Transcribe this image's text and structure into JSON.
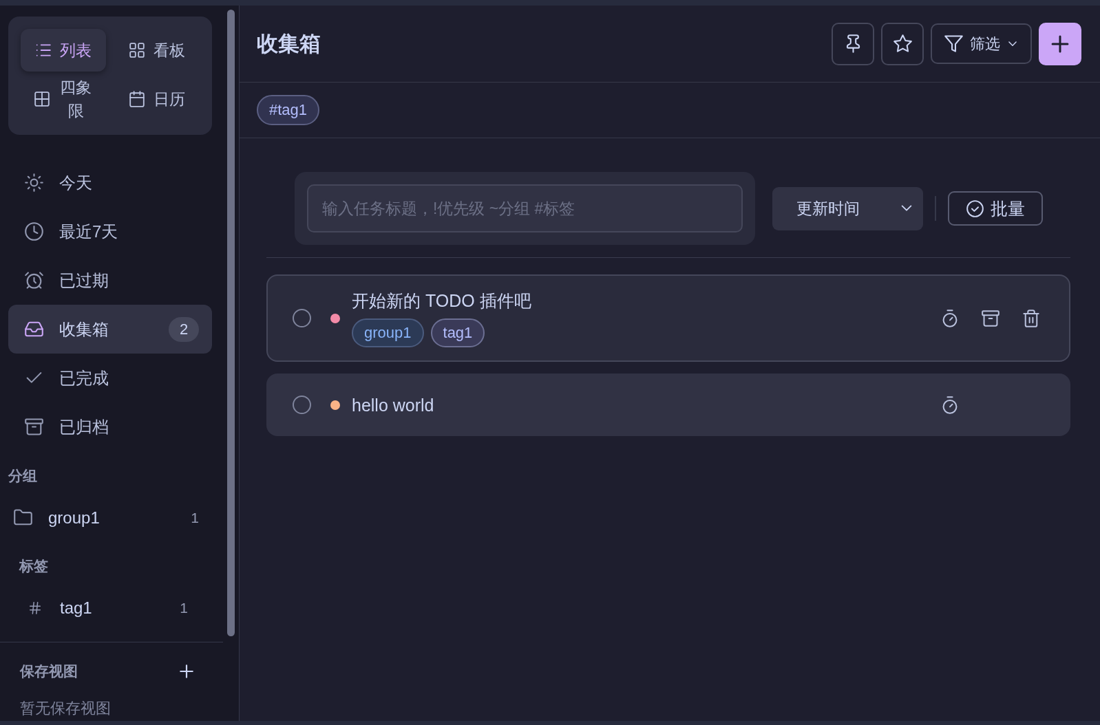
{
  "sidebar": {
    "views": [
      {
        "kind": "list",
        "label": "列表",
        "selected": true
      },
      {
        "kind": "kanban",
        "label": "看板",
        "selected": false
      },
      {
        "kind": "quadrant",
        "label": "四象限",
        "selected": false
      },
      {
        "kind": "calendar",
        "label": "日历",
        "selected": false
      }
    ],
    "nav": [
      {
        "kind": "today",
        "label": "今天",
        "selected": false
      },
      {
        "kind": "next7",
        "label": "最近7天",
        "selected": false
      },
      {
        "kind": "overdue",
        "label": "已过期",
        "selected": false
      },
      {
        "kind": "inbox",
        "label": "收集箱",
        "selected": true,
        "count": "2"
      },
      {
        "kind": "completed",
        "label": "已完成",
        "selected": false
      },
      {
        "kind": "archived",
        "label": "已归档",
        "selected": false
      }
    ],
    "groups": {
      "title": "分组",
      "items": [
        {
          "label": "group1",
          "count": "1",
          "selected": false
        }
      ]
    },
    "tags": {
      "title": "标签",
      "items": [
        {
          "label": "tag1",
          "count": "1",
          "selected": false
        }
      ]
    },
    "saved_views": {
      "title": "保存视图",
      "empty_text": "暂无保存视图"
    }
  },
  "main": {
    "title": "收集箱",
    "toolbar": [
      {
        "kind": "pin"
      },
      {
        "kind": "star"
      },
      {
        "kind": "filter",
        "label": "筛选"
      },
      {
        "kind": "add"
      }
    ],
    "active_filters": [
      {
        "label": "#tag1"
      }
    ],
    "quick_add": {
      "placeholder": "输入任务标题，!优先级 ~分组 #标签"
    },
    "sort": {
      "value": "更新时间"
    },
    "batch_button": {
      "label": "批量"
    },
    "tasks": [
      {
        "title": "开始新的 TODO 插件吧",
        "done": false,
        "color": "#f38ba8",
        "selected": true,
        "tags": [
          {
            "kind": "group",
            "label": "group1"
          },
          {
            "kind": "tag",
            "label": "tag1"
          }
        ],
        "actions": [
          {
            "kind": "timer"
          },
          {
            "kind": "archive"
          },
          {
            "kind": "delete"
          }
        ]
      },
      {
        "title": "hello world",
        "done": false,
        "color": "#fab387",
        "selected": false,
        "actions": [
          {
            "kind": "timer"
          }
        ]
      }
    ]
  }
}
